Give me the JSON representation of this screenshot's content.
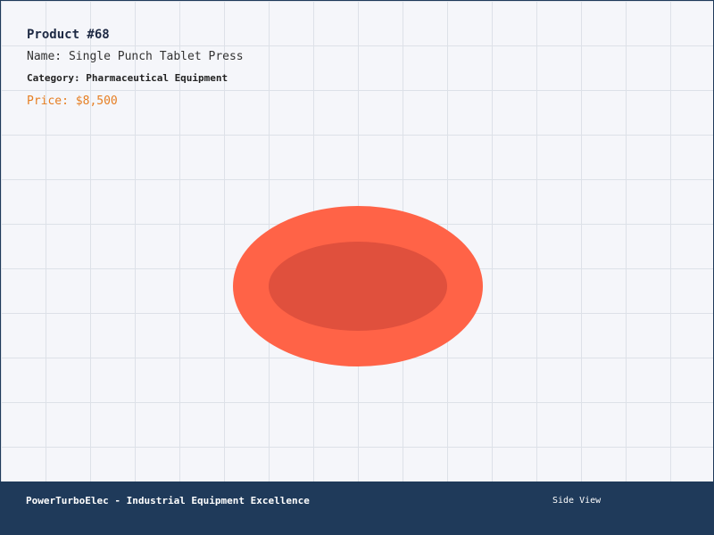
{
  "product": {
    "title": "Product #68",
    "name": "Name: Single Punch Tablet Press",
    "category": "Category: Pharmaceutical Equipment",
    "price": "Price: $8,500"
  },
  "footer": {
    "brand": "PowerTurboElec - Industrial Equipment Excellence",
    "view": "Side View"
  },
  "colors": {
    "outer_ellipse": "#ff6347",
    "inner_ellipse": "#e0503d",
    "price": "#e67e22",
    "footer_bg": "#1f3a5a",
    "grid": "#dde1e8",
    "background": "#f5f6fa"
  }
}
